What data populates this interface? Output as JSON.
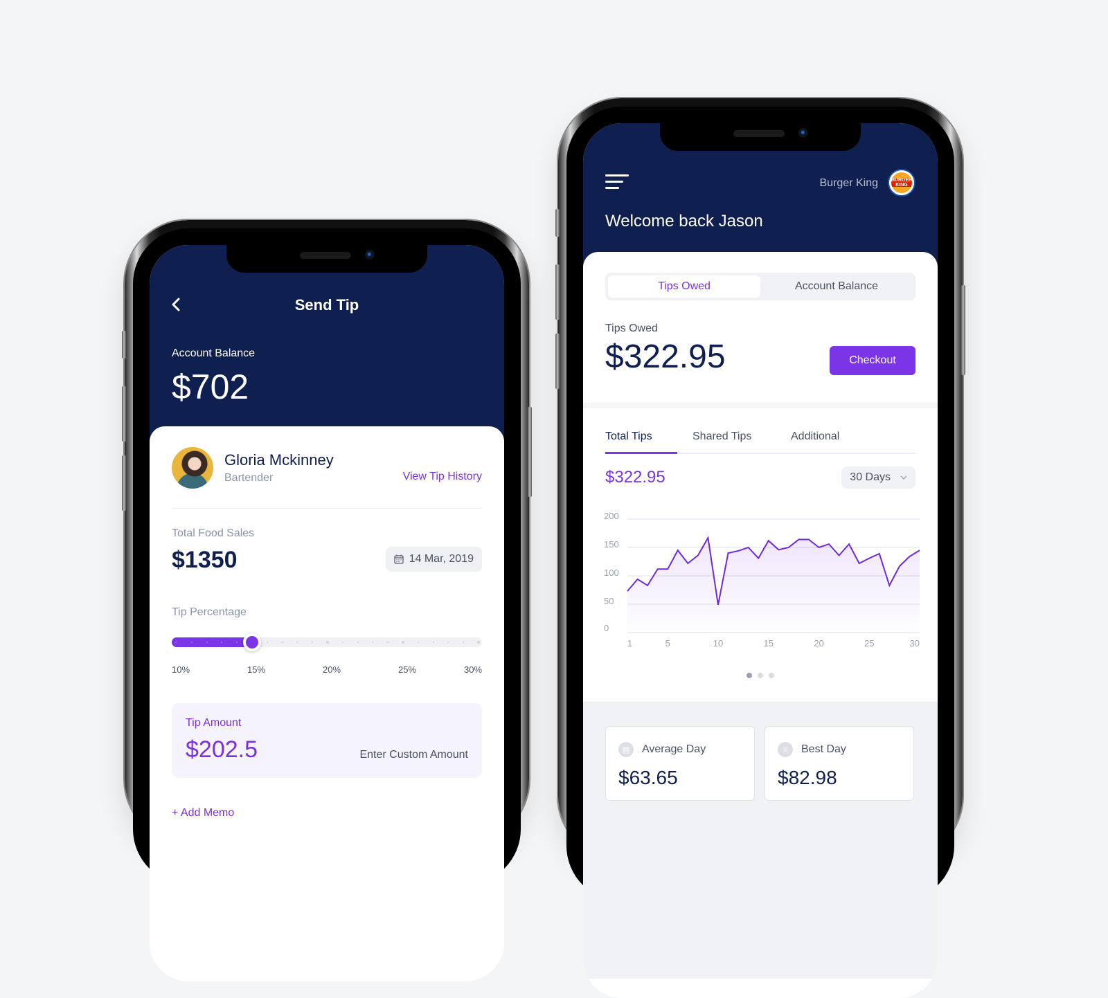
{
  "send_tip_screen": {
    "title": "Send Tip",
    "account_balance_label": "Account Balance",
    "account_balance": "$702",
    "employee": {
      "name": "Gloria Mckinney",
      "role": "Bartender"
    },
    "view_tip_history": "View Tip History",
    "total_food_sales_label": "Total Food Sales",
    "total_food_sales": "$1350",
    "date": "14 Mar, 2019",
    "tip_percentage_label": "Tip Percentage",
    "tip_percentage_value": 15,
    "tip_percentage_range": [
      10,
      30
    ],
    "tip_percentage_ticks": [
      "10%",
      "15%",
      "20%",
      "25%",
      "30%"
    ],
    "tip_amount_label": "Tip Amount",
    "tip_amount": "$202.5",
    "enter_custom_amount": "Enter Custom Amount",
    "add_memo": "+ Add Memo"
  },
  "dashboard_screen": {
    "restaurant": "Burger King",
    "logo_text": "BURGER KING",
    "welcome": "Welcome back Jason",
    "segments": [
      {
        "label": "Tips Owed",
        "active": true
      },
      {
        "label": "Account Balance",
        "active": false
      }
    ],
    "tips_owed_label": "Tips Owed",
    "tips_owed": "$322.95",
    "checkout_label": "Checkout",
    "tabs": [
      {
        "label": "Total Tips",
        "active": true
      },
      {
        "label": "Shared Tips",
        "active": false
      },
      {
        "label": "Additional",
        "active": false
      }
    ],
    "total_tips_value": "$322.95",
    "period_select": "30 Days",
    "carousel": {
      "count": 3,
      "active": 0
    },
    "stats": [
      {
        "icon": "receipt-icon",
        "label": "Average Day",
        "value": "$63.65"
      },
      {
        "icon": "trophy-icon",
        "label": "Best Day",
        "value": "$82.98"
      }
    ]
  },
  "colors": {
    "navy": "#0f1f4f",
    "accent": "#7b35e6",
    "background": "#f4f5f7"
  },
  "chart_data": {
    "type": "area",
    "title": "Total Tips",
    "xlabel": "",
    "ylabel": "",
    "x": [
      1,
      2,
      3,
      4,
      5,
      6,
      7,
      8,
      9,
      10,
      11,
      12,
      13,
      14,
      15,
      16,
      17,
      18,
      19,
      20,
      21,
      22,
      23,
      24,
      25,
      26,
      27,
      28,
      29,
      30
    ],
    "values": [
      73,
      94,
      83,
      112,
      112,
      145,
      122,
      136,
      167,
      49,
      140,
      144,
      150,
      131,
      162,
      146,
      150,
      164,
      164,
      150,
      156,
      136,
      156,
      122,
      131,
      139,
      83,
      117,
      134,
      145
    ],
    "xticks": [
      1,
      5,
      10,
      15,
      20,
      25,
      30
    ],
    "yticks": [
      0,
      50,
      100,
      150,
      200
    ],
    "ylim": [
      0,
      200
    ],
    "xlim": [
      1,
      30
    ],
    "grid": true,
    "legend": "none"
  }
}
